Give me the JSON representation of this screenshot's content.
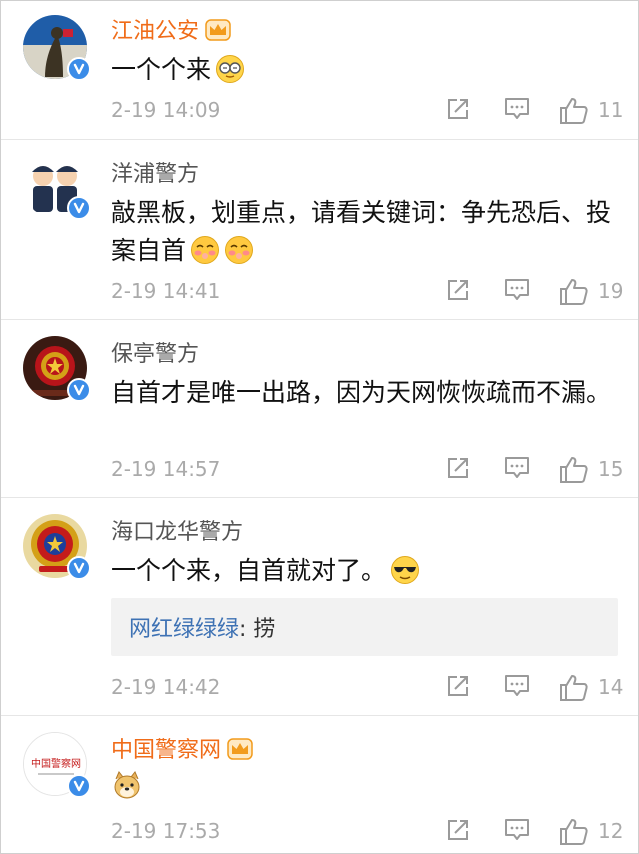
{
  "comments": [
    {
      "name": "江油公安",
      "crown": true,
      "text": "一个个来",
      "emoji": "sleepy-glasses-emoji",
      "time": "2-19 14:09",
      "likes": "11"
    },
    {
      "name": "洋浦警方",
      "crown": false,
      "text": "敲黑板，划重点，请看关键词：争先恐后、投案自首",
      "emoji": "blush-emoji",
      "time": "2-19 14:41",
      "likes": "19"
    },
    {
      "name": "保亭警方",
      "crown": false,
      "text": "自首才是唯一出路，因为天网恢恢疏而不漏。",
      "time": "2-19 14:57",
      "likes": "15"
    },
    {
      "name": "海口龙华警方",
      "crown": false,
      "text": "一个个来，自首就对了。",
      "emoji": "sunglasses-emoji",
      "reply": {
        "user": "网红绿绿绿",
        "text": ": 捞"
      },
      "time": "2-19 14:42",
      "likes": "14"
    },
    {
      "name": "中国警察网",
      "crown": true,
      "text": "",
      "emoji": "doge-emoji",
      "time": "2-19 17:53",
      "likes": "12",
      "avatar_text": "中国警察网"
    }
  ],
  "colors": {
    "orange_name": "#f06c19",
    "verified_blue": "#3b8ce8",
    "reply_link": "#3e72b4",
    "meta_gray": "#aaaaaa"
  }
}
